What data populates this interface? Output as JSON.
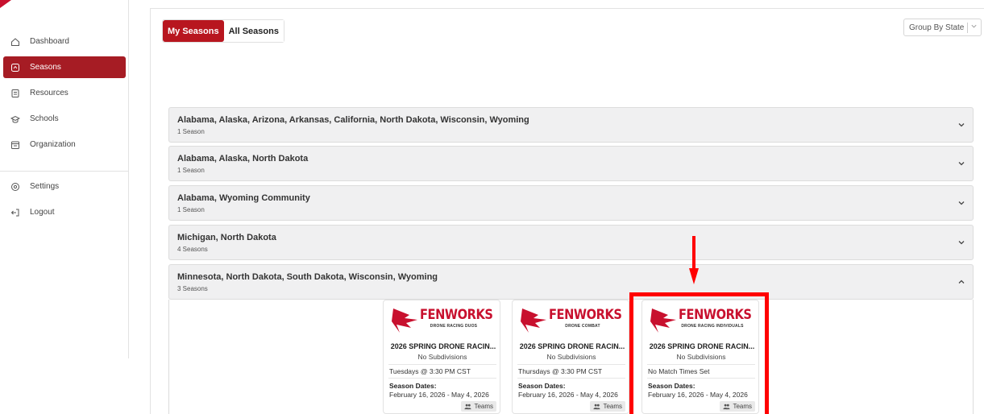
{
  "nav": {
    "items": [
      {
        "label": "Dashboard",
        "icon": "home-icon"
      },
      {
        "label": "Seasons",
        "icon": "calendar-icon"
      },
      {
        "label": "Resources",
        "icon": "document-icon"
      },
      {
        "label": "Schools",
        "icon": "school-icon"
      },
      {
        "label": "Organization",
        "icon": "building-icon"
      },
      {
        "label": "Settings",
        "icon": "gear-icon"
      },
      {
        "label": "Logout",
        "icon": "logout-icon"
      }
    ]
  },
  "tabs": {
    "my": "My Seasons",
    "all": "All Seasons"
  },
  "group_select": {
    "value": "Group By State"
  },
  "groups": [
    {
      "title": "Alabama, Alaska, Arizona, Arkansas, California, North Dakota, Wisconsin, Wyoming",
      "count": "1 Season"
    },
    {
      "title": "Alabama, Alaska, North Dakota",
      "count": "1 Season"
    },
    {
      "title": "Alabama, Wyoming Community",
      "count": "1 Season"
    },
    {
      "title": "Michigan, North Dakota",
      "count": "4 Seasons"
    },
    {
      "title": "Minnesota, North Dakota, South Dakota, Wisconsin, Wyoming",
      "count": "3 Seasons"
    }
  ],
  "cards": [
    {
      "brand": "FENWORKS",
      "subtitle": "DRONE RACING DUOS",
      "title": "2026 SPRING DRONE RACIN...",
      "subdivisions": "No Subdivisions",
      "time": "Tuesdays @ 3:30 PM CST",
      "dates_label": "Season Dates:",
      "dates": "February 16, 2026 - May 4, 2026",
      "teams": "Teams"
    },
    {
      "brand": "FENWORKS",
      "subtitle": "DRONE COMBAT",
      "title": "2026 SPRING DRONE RACIN...",
      "subdivisions": "No Subdivisions",
      "time": "Thursdays @ 3:30 PM CST",
      "dates_label": "Season Dates:",
      "dates": "February 16, 2026 - May 4, 2026",
      "teams": "Teams"
    },
    {
      "brand": "FENWORKS",
      "subtitle": "DRONE RACING INDIVIDUALS",
      "title": "2026 SPRING DRONE RACIN...",
      "subdivisions": "No Subdivisions",
      "time": "No Match Times Set",
      "dates_label": "Season Dates:",
      "dates": "February 16, 2026 - May 4, 2026",
      "teams": "Teams"
    }
  ],
  "colors": {
    "accent": "#a61c24",
    "brand_red": "#c8102e",
    "highlight": "#ff0000"
  }
}
